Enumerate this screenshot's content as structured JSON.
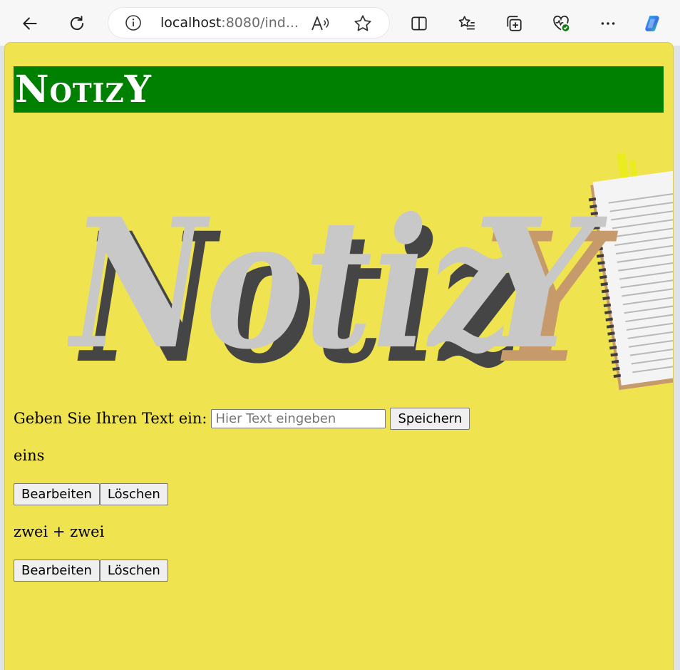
{
  "browser": {
    "url_host": "localhost",
    "url_rest": ":8080/ind...",
    "icons": [
      "back-icon",
      "refresh-icon",
      "info-icon",
      "read-aloud-icon",
      "favorite-icon",
      "split-screen-icon",
      "favorites-list-icon",
      "collections-icon",
      "health-icon",
      "more-icon",
      "copilot-icon"
    ]
  },
  "page": {
    "title": "NotizY",
    "logo_text": "NotizY",
    "form": {
      "label": "Geben Sie Ihren Text ein:",
      "placeholder": "Hier Text eingeben",
      "value": "",
      "save_label": "Speichern"
    },
    "notes": [
      {
        "text": "eins",
        "edit_label": "Bearbeiten",
        "delete_label": "Löschen"
      },
      {
        "text": "zwei + zwei",
        "edit_label": "Bearbeiten",
        "delete_label": "Löschen"
      }
    ]
  },
  "colors": {
    "page_bg": "#f0e350",
    "header_bg": "#008000",
    "header_text": "#ffffff",
    "logo_letter": "#c8c8c8",
    "logo_shadow": "#454545",
    "logo_y_shadow": "#c69a6b"
  }
}
